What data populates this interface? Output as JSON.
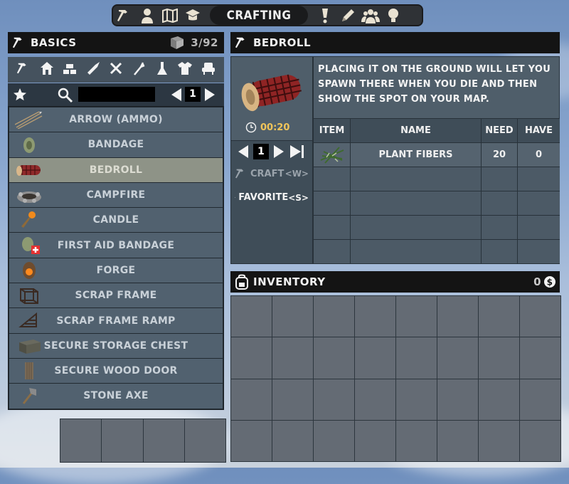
{
  "topnav": {
    "active_tab": "CRAFTING",
    "left_icons": [
      "hammer-icon",
      "character-icon",
      "map-icon",
      "skills-icon"
    ],
    "right_icons": [
      "quest-icon",
      "journal-icon",
      "players-icon",
      "tips-icon"
    ]
  },
  "recipes_panel": {
    "title": "BASICS",
    "count": "3/92",
    "page": "1",
    "categories": [
      "hammer-icon",
      "house-icon",
      "building-icon",
      "weapon-icon",
      "tools-icon",
      "food-icon",
      "science-icon",
      "clothing-icon",
      "furniture-icon"
    ],
    "items": [
      {
        "label": "ARROW (AMMO)",
        "icon": "arrow-icon"
      },
      {
        "label": "BANDAGE",
        "icon": "bandage-icon"
      },
      {
        "label": "BEDROLL",
        "icon": "bedroll-icon",
        "selected": true
      },
      {
        "label": "CAMPFIRE",
        "icon": "campfire-icon"
      },
      {
        "label": "CANDLE",
        "icon": "candle-icon"
      },
      {
        "label": "FIRST AID BANDAGE",
        "icon": "first-aid-icon"
      },
      {
        "label": "FORGE",
        "icon": "forge-icon"
      },
      {
        "label": "SCRAP FRAME",
        "icon": "frame-icon"
      },
      {
        "label": "SCRAP FRAME RAMP",
        "icon": "ramp-icon"
      },
      {
        "label": "SECURE STORAGE CHEST",
        "icon": "chest-icon"
      },
      {
        "label": "SECURE WOOD DOOR",
        "icon": "door-icon"
      },
      {
        "label": "STONE AXE",
        "icon": "axe-icon"
      }
    ]
  },
  "detail": {
    "title": "BEDROLL",
    "description": "PLACING IT ON THE GROUND WILL LET YOU SPAWN THERE WHEN YOU DIE AND THEN SHOW THE SPOT ON YOUR MAP.",
    "time": "00:20",
    "quantity": "1",
    "craft_label": "CRAFT",
    "craft_key": "<W>",
    "favorite_label": "FAVORITE",
    "favorite_key": "<S>",
    "table": {
      "headers": [
        "ITEM",
        "NAME",
        "NEED",
        "HAVE"
      ],
      "rows": [
        {
          "name": "PLANT FIBERS",
          "need": "20",
          "have": "0"
        }
      ]
    }
  },
  "inventory": {
    "title": "INVENTORY",
    "currency": "0"
  },
  "colors": {
    "header_bg": "#141414",
    "row_bg": "#51616f",
    "row_selected_bg": "#8e9387",
    "craft_disabled": "#9aa3ab"
  }
}
